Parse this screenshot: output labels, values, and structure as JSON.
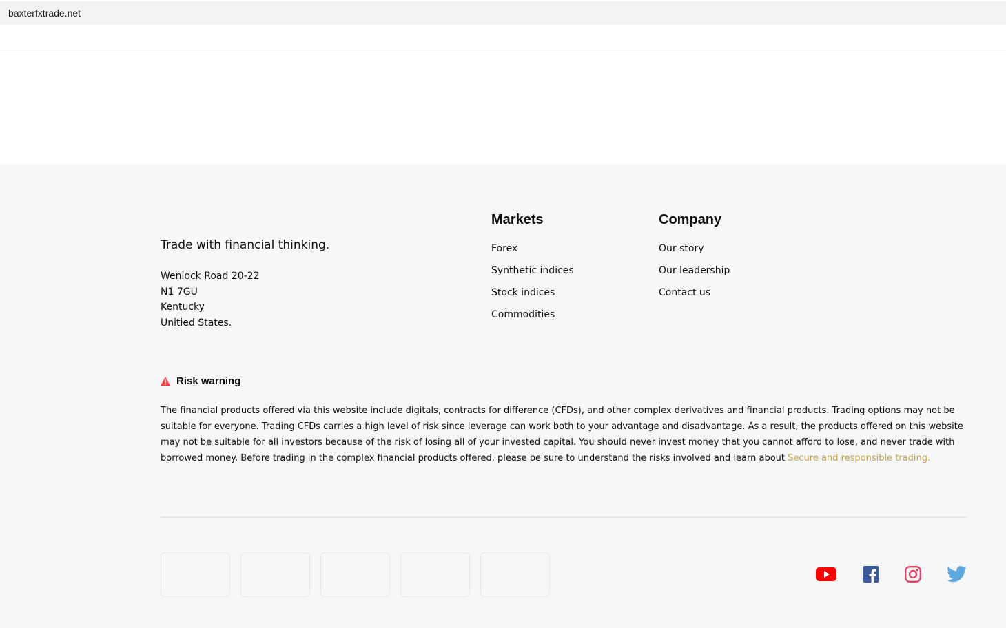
{
  "browser": {
    "url": "baxterfxtrade.net"
  },
  "footer": {
    "tagline": "Trade with financial thinking.",
    "address": [
      "Wenlock Road 20-22",
      "N1 7GU",
      "Kentucky",
      "Unitied States."
    ],
    "markets": {
      "title": "Markets",
      "items": [
        "Forex",
        "Synthetic indices",
        "Stock indices",
        "Commodities"
      ]
    },
    "company": {
      "title": "Company",
      "items": [
        "Our story",
        "Our leadership",
        "Contact us"
      ]
    },
    "risk": {
      "title": "Risk warning",
      "text": "The financial products offered via this website include digitals, contracts for difference (CFDs), and other complex derivatives and financial products. Trading options may not be suitable for everyone. Trading CFDs carries a high level of risk since leverage can work both to your advantage and disadvantage. As a result, the products offered on this website may not be suitable for all investors because of the risk of losing all of your invested capital. You should never invest money that you cannot afford to lose, and never trade with borrowed money. Before trading in the complex financial products offered, please be sure to understand the risks involved and learn about ",
      "link": "Secure and responsible trading."
    },
    "social": [
      "youtube-icon",
      "facebook-icon",
      "instagram-icon",
      "twitter-icon"
    ],
    "colors": {
      "link": "#c8a04a",
      "warning": "#ff444f",
      "youtube": "#ff0000",
      "facebook": "#3b5998",
      "instagram": "#e4405f",
      "twitter": "#5ca8df"
    }
  }
}
